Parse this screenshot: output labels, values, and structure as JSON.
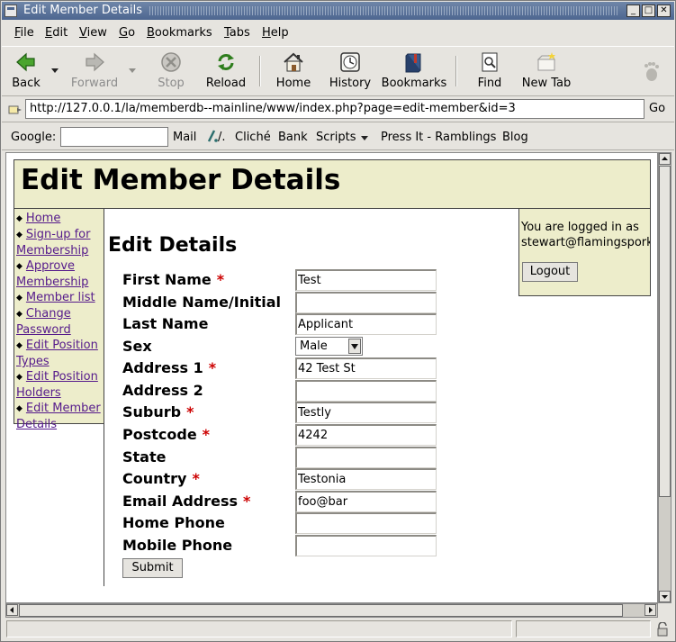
{
  "window": {
    "title": "Edit Member Details",
    "controls": [
      "_",
      "□",
      "✕"
    ]
  },
  "menubar": {
    "items": [
      "File",
      "Edit",
      "View",
      "Go",
      "Bookmarks",
      "Tabs",
      "Help"
    ]
  },
  "toolbar": {
    "back": "Back",
    "forward": "Forward",
    "stop": "Stop",
    "reload": "Reload",
    "home": "Home",
    "history": "History",
    "bookmarks": "Bookmarks",
    "find": "Find",
    "new_tab": "New Tab"
  },
  "address": {
    "url": "http://127.0.0.1/la/memberdb--mainline/www/index.php?page=edit-member&id=3",
    "go": "Go"
  },
  "personal_bar": {
    "google_label": "Google:",
    "items": [
      "Mail",
      "/.",
      "Cliché",
      "Bank",
      "Scripts",
      "Press It - Ramblings",
      "Blog"
    ]
  },
  "page": {
    "header_title": "Edit Member Details",
    "nav": [
      "Home",
      "Sign-up for Membership",
      "Approve Membership",
      "Member list",
      "Change Password",
      "Edit Position Types",
      "Edit Position Holders",
      "Edit Member Details"
    ],
    "section_title": "Edit Details",
    "form": [
      {
        "label": "First Name",
        "required": "*",
        "value": "Test"
      },
      {
        "label": "Middle Name/Initial",
        "required": "",
        "value": ""
      },
      {
        "label": "Last Name",
        "required": "",
        "value": "Applicant"
      },
      {
        "label": "Sex",
        "required": "",
        "value": "Male"
      },
      {
        "label": "Address 1",
        "required": "*",
        "value": "42 Test St"
      },
      {
        "label": "Address 2",
        "required": "",
        "value": ""
      },
      {
        "label": "Suburb",
        "required": "*",
        "value": "Testly"
      },
      {
        "label": "Postcode",
        "required": "*",
        "value": "4242"
      },
      {
        "label": "State",
        "required": "",
        "value": ""
      },
      {
        "label": "Country",
        "required": "*",
        "value": "Testonia"
      },
      {
        "label": "Email Address",
        "required": "*",
        "value": "foo@bar"
      },
      {
        "label": "Home Phone",
        "required": "",
        "value": ""
      },
      {
        "label": "Mobile Phone",
        "required": "",
        "value": ""
      }
    ],
    "submit": "Submit",
    "login_line1": "You are logged in as",
    "login_user": "stewart@flamingspork.com",
    "logout": "Logout"
  },
  "colors": {
    "title_bar": "#4d6690",
    "panel_bg": "#ededcb",
    "required": "#cc0000",
    "link": "#551a8b"
  }
}
